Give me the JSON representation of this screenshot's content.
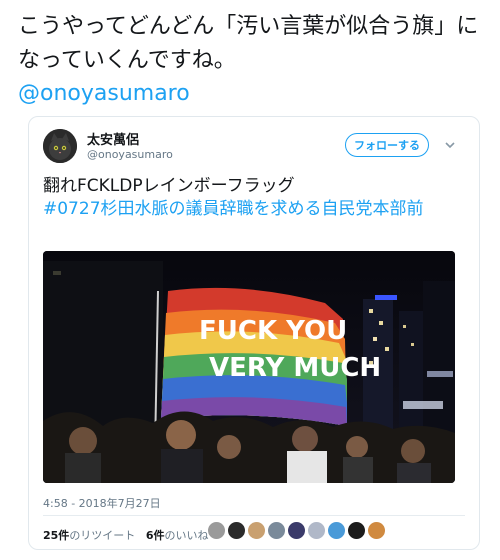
{
  "headline": "こうやってどんどん「汚い言葉が似合う旗」になっていくんですね。",
  "source_handle": "@onoyasumaro",
  "tweet": {
    "author_name": "太安萬侶",
    "author_handle": "@onoyasumaro",
    "follow_label": "フォローする",
    "text_plain": "翻れFCKLDPレインボーフラッグ",
    "hashtag": "#0727杉田水脈の議員辞職を求める自民党本部前",
    "flag_line1": "FUCK YOU",
    "flag_line2": "VERY MUCH",
    "timestamp": "4:58 - 2018年7月27日",
    "retweets_count": "25件",
    "retweets_label": "のリツイート",
    "likes_count": "6件",
    "likes_label": "のいいね"
  },
  "colors": {
    "link": "#1da1f2",
    "text": "#14171a",
    "muted": "#657786",
    "border": "#e1e8ed"
  },
  "icons": {
    "caret": "chevron-down-icon",
    "avatar": "cat-avatar"
  }
}
